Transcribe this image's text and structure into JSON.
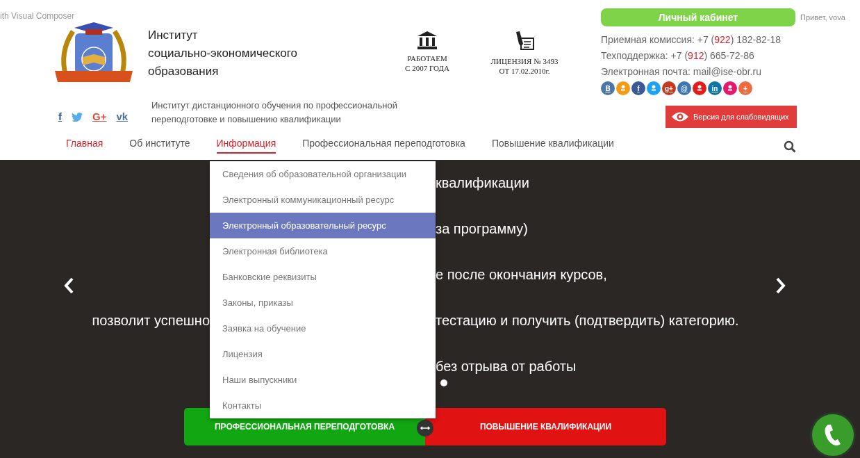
{
  "top_bar": {
    "builder_text": "ith Visual Composer",
    "cabinet_button": "Личный кабинет",
    "greeting": "Привет, vova"
  },
  "brand": {
    "title_lines": [
      "Институт",
      "социально-экономического",
      "образования"
    ],
    "tagline": "Институт дистанционного обучения по профессиональной переподготовке и повышению квалификации"
  },
  "features": [
    {
      "kind": "building",
      "lines": [
        "РАБОТАЕМ",
        "С 2007 ГОДА"
      ]
    },
    {
      "kind": "license",
      "lines": [
        "ЛИЦЕНЗИЯ № 3493",
        "ОТ 17.02.2010г."
      ]
    }
  ],
  "social": [
    {
      "kind": "facebook",
      "glyph": "f",
      "color": "#3b5998"
    },
    {
      "kind": "twitter",
      "color": "#55acee"
    },
    {
      "kind": "googleplus",
      "glyph": "G+",
      "color": "#dd4b39"
    },
    {
      "kind": "vk",
      "glyph": "vk",
      "color": "#4c75a3"
    }
  ],
  "contacts": [
    {
      "prefix": "Приемная комиссия: +7 (",
      "code": "922",
      "suffix": ") 182-82-18"
    },
    {
      "prefix": "Техподдержка: +7 (",
      "code": "912",
      "suffix": ") 665-72-86"
    },
    {
      "prefix": "Электронная почта: mail@ise-obr.ru"
    }
  ],
  "share_icons": [
    {
      "glyph": "B",
      "color": "#4a76a8"
    },
    {
      "color": "#f59a13"
    },
    {
      "glyph": "f",
      "color": "#3b5998"
    },
    {
      "color": "#1da1f2"
    },
    {
      "glyph": "g+",
      "color": "#c5391e"
    },
    {
      "glyph": "@",
      "color": "#3d74b5"
    },
    {
      "color": "#e31c1c"
    },
    {
      "glyph": "in",
      "color": "#0e76a8"
    },
    {
      "color": "#e8176e"
    },
    {
      "glyph": "+",
      "color": "#ec6b40"
    }
  ],
  "accessibility_button": "Версия для слабовидящих",
  "nav": [
    {
      "label": "Главная",
      "current": true,
      "selected": false
    },
    {
      "label": "Об институте",
      "current": false,
      "selected": false
    },
    {
      "label": "Информация",
      "current": false,
      "selected": true
    },
    {
      "label": "Профессиональная переподготовка",
      "current": false,
      "selected": false
    },
    {
      "label": "Повышение квалификации",
      "current": false,
      "selected": false
    }
  ],
  "dropdown": [
    {
      "label": "Сведения об образовательной организации",
      "selected": false
    },
    {
      "label": "Электронный коммуникационный ресурс",
      "selected": false
    },
    {
      "label": "Электронный образовательный ресурс",
      "selected": true
    },
    {
      "label": "Электронная библиотека",
      "selected": false
    },
    {
      "label": "Банковские реквизиты",
      "selected": false
    },
    {
      "label": "Законы, приказы",
      "selected": false
    },
    {
      "label": "Заявка на обучение",
      "selected": false
    },
    {
      "label": "Лицензия",
      "selected": false
    },
    {
      "label": "Наши выпускники",
      "selected": false
    },
    {
      "label": "Контакты",
      "selected": false
    }
  ],
  "hero_lines": [
    {
      "right": "квалификации"
    },
    {
      "right": "за программу)"
    },
    {
      "right": "е после окончания курсов,"
    },
    {
      "left": "позволит успешно",
      "right": "тестацию и получить (подтвердить) категорию."
    },
    {
      "right": "без отрыва от работы"
    }
  ],
  "cta_buttons": [
    {
      "label": "ПРОФЕССИОНАЛЬНАЯ ПЕРЕПОДГОТОВКА",
      "color": "#12a612"
    },
    {
      "label": "ПОВЫШЕНИЕ КВАЛИФИКАЦИИ",
      "color": "#e01212"
    }
  ]
}
